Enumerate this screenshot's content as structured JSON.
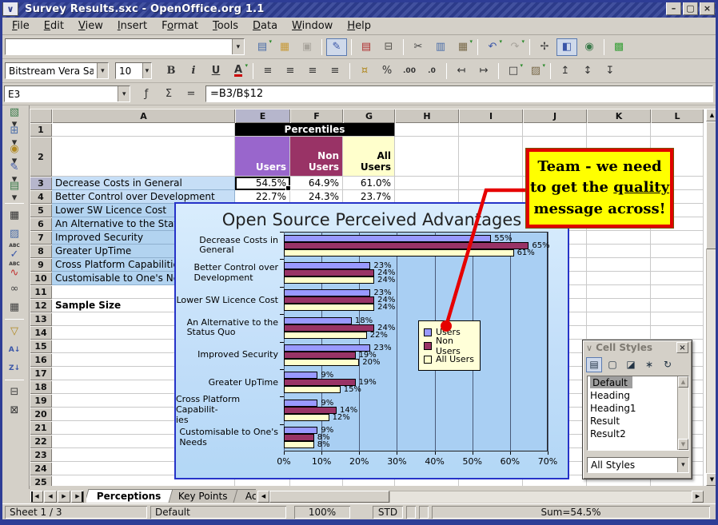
{
  "window": {
    "title": "Survey Results.sxc - OpenOffice.org 1.1",
    "minimize_glyph": "–",
    "maximize_glyph": "▢",
    "close_glyph": "×"
  },
  "menu": {
    "items": [
      {
        "label": "File",
        "accel": 0
      },
      {
        "label": "Edit",
        "accel": 0
      },
      {
        "label": "View",
        "accel": 0
      },
      {
        "label": "Insert",
        "accel": 0
      },
      {
        "label": "Format",
        "accel": 1
      },
      {
        "label": "Tools",
        "accel": 0
      },
      {
        "label": "Data",
        "accel": 0
      },
      {
        "label": "Window",
        "accel": 0
      },
      {
        "label": "Help",
        "accel": 0
      }
    ]
  },
  "toolbar_main": {
    "url_value": "",
    "buttons": [
      {
        "name": "new-document",
        "glyph": "▤",
        "color": "#4a6da8",
        "drop": true
      },
      {
        "name": "open-file",
        "glyph": "▦",
        "color": "#c79a3a"
      },
      {
        "name": "save",
        "glyph": "▣",
        "disabled": true
      },
      {
        "name": "sep"
      },
      {
        "name": "edit-file",
        "glyph": "✎",
        "color": "#3a56a8",
        "active": true
      },
      {
        "name": "sep"
      },
      {
        "name": "export-pdf",
        "glyph": "▤",
        "color": "#b03030"
      },
      {
        "name": "print",
        "glyph": "⊟",
        "color": "#55524c"
      },
      {
        "name": "sep"
      },
      {
        "name": "cut",
        "glyph": "✂",
        "color": "#444"
      },
      {
        "name": "copy",
        "glyph": "▥",
        "color": "#4a6da8"
      },
      {
        "name": "paste",
        "glyph": "▦",
        "color": "#7a6a4a",
        "drop": true
      },
      {
        "name": "sep"
      },
      {
        "name": "undo",
        "glyph": "↶",
        "color": "#3a56a8",
        "drop": true
      },
      {
        "name": "redo",
        "glyph": "↷",
        "disabled": true,
        "drop": true
      },
      {
        "name": "sep"
      },
      {
        "name": "navigator",
        "glyph": "✢",
        "color": "#444"
      },
      {
        "name": "stylist",
        "glyph": "◧",
        "color": "#3a56a8",
        "active": true
      },
      {
        "name": "hyperlink",
        "glyph": "◉",
        "color": "#3a7a4a"
      },
      {
        "name": "sep"
      },
      {
        "name": "gallery",
        "glyph": "▩",
        "color": "#3aa03a"
      }
    ]
  },
  "toolbar_format": {
    "font_name": "Bitstream Vera Sa",
    "font_size": "10",
    "buttons": [
      {
        "name": "bold",
        "glyph": "B",
        "cls": "fmt-b"
      },
      {
        "name": "italic",
        "glyph": "i",
        "cls": "fmt-i"
      },
      {
        "name": "underline",
        "glyph": "U",
        "cls": "fmt-u"
      },
      {
        "name": "font-color",
        "glyph": "A",
        "cls": "fmt-a",
        "drop": true
      },
      {
        "name": "sep"
      },
      {
        "name": "align-left",
        "glyph": "≡"
      },
      {
        "name": "align-center",
        "glyph": "≡"
      },
      {
        "name": "align-right",
        "glyph": "≡"
      },
      {
        "name": "justify",
        "glyph": "≡"
      },
      {
        "name": "sep"
      },
      {
        "name": "currency",
        "glyph": "¤",
        "color": "#b08820"
      },
      {
        "name": "percent",
        "glyph": "%"
      },
      {
        "name": "add-decimal",
        "glyph": ".00",
        "cls": "glyph-sm"
      },
      {
        "name": "delete-decimal",
        "glyph": ".0",
        "cls": "glyph-sm"
      },
      {
        "name": "sep"
      },
      {
        "name": "decrease-indent",
        "glyph": "↤"
      },
      {
        "name": "increase-indent",
        "glyph": "↦"
      },
      {
        "name": "sep"
      },
      {
        "name": "borders",
        "glyph": "□",
        "drop": true
      },
      {
        "name": "background-color",
        "glyph": "▨",
        "color": "#7a6a4a",
        "drop": true
      },
      {
        "name": "sep"
      },
      {
        "name": "align-top",
        "glyph": "↥"
      },
      {
        "name": "align-center-vertical",
        "glyph": "↕"
      },
      {
        "name": "align-bottom",
        "glyph": "↧"
      }
    ]
  },
  "formula_bar": {
    "cell_ref": "E3",
    "formula": "=B3/B$12",
    "buttons": [
      {
        "name": "function-wizard",
        "glyph": "ƒ"
      },
      {
        "name": "sum",
        "glyph": "Σ"
      },
      {
        "name": "equals",
        "glyph": "="
      }
    ]
  },
  "left_toolbar": {
    "buttons": [
      {
        "name": "insert-object",
        "glyph": "▧",
        "color": "#3a7a4a",
        "drop": true
      },
      {
        "name": "insert-cells",
        "glyph": "⊞",
        "color": "#4a6da8",
        "drop": true
      },
      {
        "name": "insert-chart",
        "glyph": "◉",
        "color": "#b08820",
        "drop": true
      },
      {
        "name": "draw-functions",
        "glyph": "✎",
        "color": "#3a56a8",
        "drop": true
      },
      {
        "name": "form-functions",
        "glyph": "▤",
        "color": "#3a7a4a",
        "drop": true
      },
      {
        "name": "sep"
      },
      {
        "name": "autoformat",
        "glyph": "▦",
        "disabled": true
      },
      {
        "name": "choose-themes",
        "glyph": "▨",
        "color": "#4a6da8"
      },
      {
        "name": "spellcheck",
        "glyph": "✓",
        "color": "#3a56a8",
        "label": "ABC"
      },
      {
        "name": "autospellcheck",
        "glyph": "∿",
        "color": "#c03030",
        "label": "ABC"
      },
      {
        "name": "find-replace",
        "glyph": "∞",
        "color": "#444"
      },
      {
        "name": "data-sources",
        "glyph": "▦",
        "color": "#444"
      },
      {
        "name": "sep"
      },
      {
        "name": "filter",
        "glyph": "▽",
        "color": "#b08820"
      },
      {
        "name": "sort-ascending",
        "glyph": "A↓",
        "cls": "glyph-sm",
        "color": "#3a56a8"
      },
      {
        "name": "sort-descending",
        "glyph": "Z↓",
        "cls": "glyph-sm",
        "color": "#3a56a8"
      },
      {
        "name": "sep"
      },
      {
        "name": "group",
        "glyph": "⊟",
        "color": "#444"
      },
      {
        "name": "ungroup",
        "glyph": "⊠",
        "disabled": true
      }
    ]
  },
  "grid": {
    "columns": [
      "A",
      "E",
      "F",
      "G",
      "H",
      "I",
      "J",
      "K",
      "L"
    ],
    "row_numbers": [
      1,
      2,
      3,
      4,
      5,
      6,
      7,
      8,
      9,
      10,
      11,
      12,
      13,
      14,
      15,
      16,
      17,
      18,
      19,
      20,
      21,
      22,
      23,
      24,
      25
    ],
    "selected_column": "E",
    "selected_row": 3
  },
  "sheet": {
    "merged_header": "Percentiles",
    "series_headers": [
      {
        "label": "Users",
        "bg": "#9966CC",
        "fg": "#FFFFFF"
      },
      {
        "label": "Non\nUsers",
        "bg": "#993366",
        "fg": "#FFFFFF"
      },
      {
        "label": "All\nUsers",
        "bg": "#FFFFCC",
        "fg": "#000000"
      }
    ],
    "data_rows": [
      {
        "row": 3,
        "label": "Decrease Costs in General",
        "values": [
          "54.5%",
          "64.9%",
          "61.0%"
        ]
      },
      {
        "row": 4,
        "label": "Better Control over Development",
        "values": [
          "22.7%",
          "24.3%",
          "23.7%"
        ]
      },
      {
        "row": 5,
        "label": "Lower SW Licence Cost",
        "values": []
      },
      {
        "row": 6,
        "label": "An Alternative to the Status Quo",
        "values": []
      },
      {
        "row": 7,
        "label": "Improved Security",
        "values": []
      },
      {
        "row": 8,
        "label": "Greater UpTime",
        "values": []
      },
      {
        "row": 9,
        "label": "Cross Platform Capabilities",
        "values": []
      },
      {
        "row": 10,
        "label": "Customisable to One's Needs",
        "values": []
      }
    ],
    "sample_size_row": 12,
    "sample_size_label": "Sample Size"
  },
  "chart_data": {
    "type": "bar",
    "orientation": "horizontal",
    "title": "Open Source Perceived Advantages",
    "categories": [
      "Decrease Costs in\nGeneral",
      "Better Control over\nDevelopment",
      "Lower SW Licence Cost",
      "An Alternative to the\nStatus Quo",
      "Improved Security",
      "Greater UpTime",
      "Cross Platform Capabilit-\nies",
      "Customisable to One's\nNeeds"
    ],
    "series": [
      {
        "name": "Users",
        "color": "#9999FF",
        "values": [
          55,
          23,
          23,
          18,
          23,
          9,
          9,
          9
        ]
      },
      {
        "name": "Non Users",
        "color": "#993366",
        "values": [
          65,
          24,
          24,
          24,
          19,
          19,
          14,
          8
        ]
      },
      {
        "name": "All Users",
        "color": "#FFFFCC",
        "values": [
          61,
          24,
          24,
          22,
          20,
          15,
          12,
          8
        ]
      }
    ],
    "xlim": [
      0,
      70
    ],
    "x_ticks": [
      "0%",
      "10%",
      "20%",
      "30%",
      "40%",
      "50%",
      "60%",
      "70%"
    ],
    "grid": true,
    "legend_position": "middle-right",
    "data_label_suffix": "%"
  },
  "callout": {
    "line1": "Team - we need",
    "line2_pre": "to get the ",
    "line2_underlined": "quality",
    "line3": "message across!"
  },
  "cell_styles": {
    "title": "Cell Styles",
    "dock_glyph": "∨",
    "close_glyph": "×",
    "buttons": [
      {
        "name": "cell-styles-view",
        "glyph": "▤",
        "active": true
      },
      {
        "name": "page-styles-view",
        "glyph": "▢"
      },
      {
        "name": "fill-format-mode",
        "glyph": "◪"
      },
      {
        "name": "new-style-from-selection",
        "glyph": "∗"
      },
      {
        "name": "update-style",
        "glyph": "↻"
      }
    ],
    "styles": [
      "Default",
      "Heading",
      "Heading1",
      "Result",
      "Result2"
    ],
    "selected_style": "Default",
    "filter_value": "All Styles"
  },
  "tabbar": {
    "nav": [
      {
        "name": "first-sheet",
        "glyph": "◀",
        "bar": "left"
      },
      {
        "name": "previous-sheet",
        "glyph": "◀"
      },
      {
        "name": "next-sheet",
        "glyph": "▶"
      },
      {
        "name": "last-sheet",
        "glyph": "▶",
        "bar": "right"
      }
    ],
    "sheets": [
      "Perceptions",
      "Key Points",
      "Actions"
    ],
    "active_sheet": "Perceptions"
  },
  "status_bar": {
    "sheet_position": "Sheet 1 / 3",
    "page_style": "Default",
    "zoom": "100%",
    "selection_mode": "STD",
    "sum": "Sum=54.5%"
  }
}
